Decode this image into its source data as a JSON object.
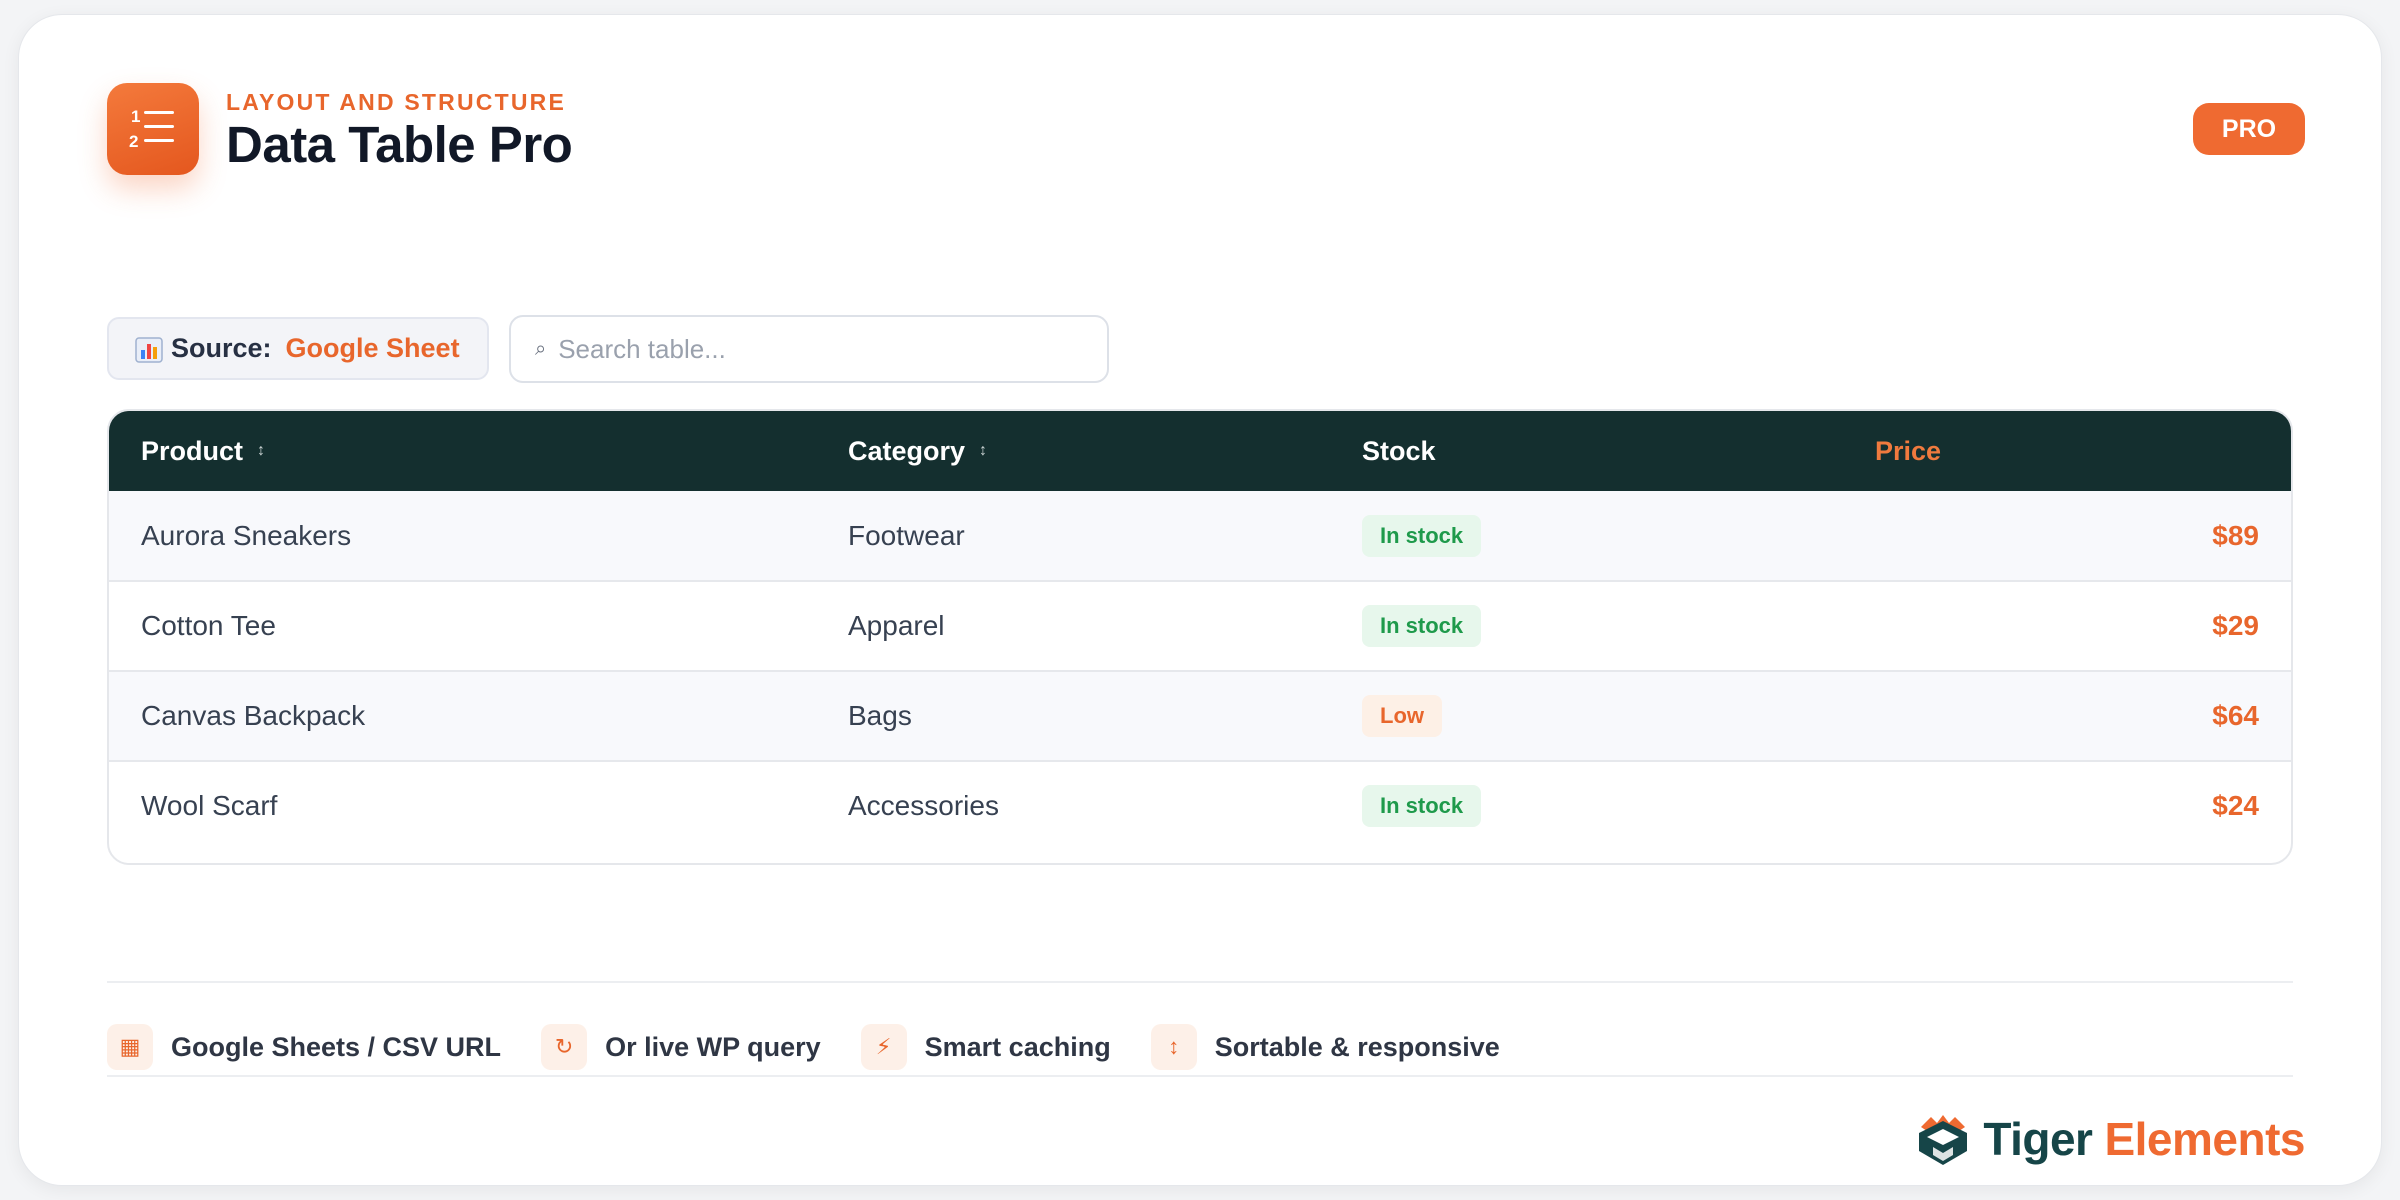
{
  "header": {
    "eyebrow": "LAYOUT AND STRUCTURE",
    "title": "Data Table Pro",
    "badge": "PRO",
    "app_icon": "numbered-list-icon"
  },
  "toolbar": {
    "source_label": "Source:",
    "source_value": "Google Sheet",
    "source_icon": "bar-chart-icon",
    "search_placeholder": "Search table...",
    "search_icon": "search-icon"
  },
  "table": {
    "columns": [
      {
        "label": "Product",
        "sortable": true
      },
      {
        "label": "Category",
        "sortable": true
      },
      {
        "label": "Stock",
        "sortable": false
      },
      {
        "label": "Price",
        "sortable": false
      }
    ],
    "rows": [
      {
        "product": "Aurora Sneakers",
        "category": "Footwear",
        "stock": "In stock",
        "stock_status": "ok",
        "price": "$89"
      },
      {
        "product": "Cotton Tee",
        "category": "Apparel",
        "stock": "In stock",
        "stock_status": "ok",
        "price": "$29"
      },
      {
        "product": "Canvas Backpack",
        "category": "Bags",
        "stock": "Low",
        "stock_status": "low",
        "price": "$64"
      },
      {
        "product": "Wool Scarf",
        "category": "Accessories",
        "stock": "In stock",
        "stock_status": "ok",
        "price": "$24"
      }
    ]
  },
  "features": [
    {
      "icon": "grid-icon",
      "glyph": "▦",
      "label": "Google Sheets / CSV URL"
    },
    {
      "icon": "refresh-icon",
      "glyph": "↻",
      "label": "Or live WP query"
    },
    {
      "icon": "lightning-icon",
      "glyph": "⚡",
      "label": "Smart caching"
    },
    {
      "icon": "sort-icon",
      "glyph": "↕",
      "label": "Sortable & responsive"
    }
  ],
  "brand": {
    "name_part1": "Tiger",
    "name_part2": "Elements"
  },
  "colors": {
    "accent": "#ef6a31",
    "header_bg": "#142f2f",
    "brand_dark": "#164548",
    "success": "#1e9a4b"
  }
}
